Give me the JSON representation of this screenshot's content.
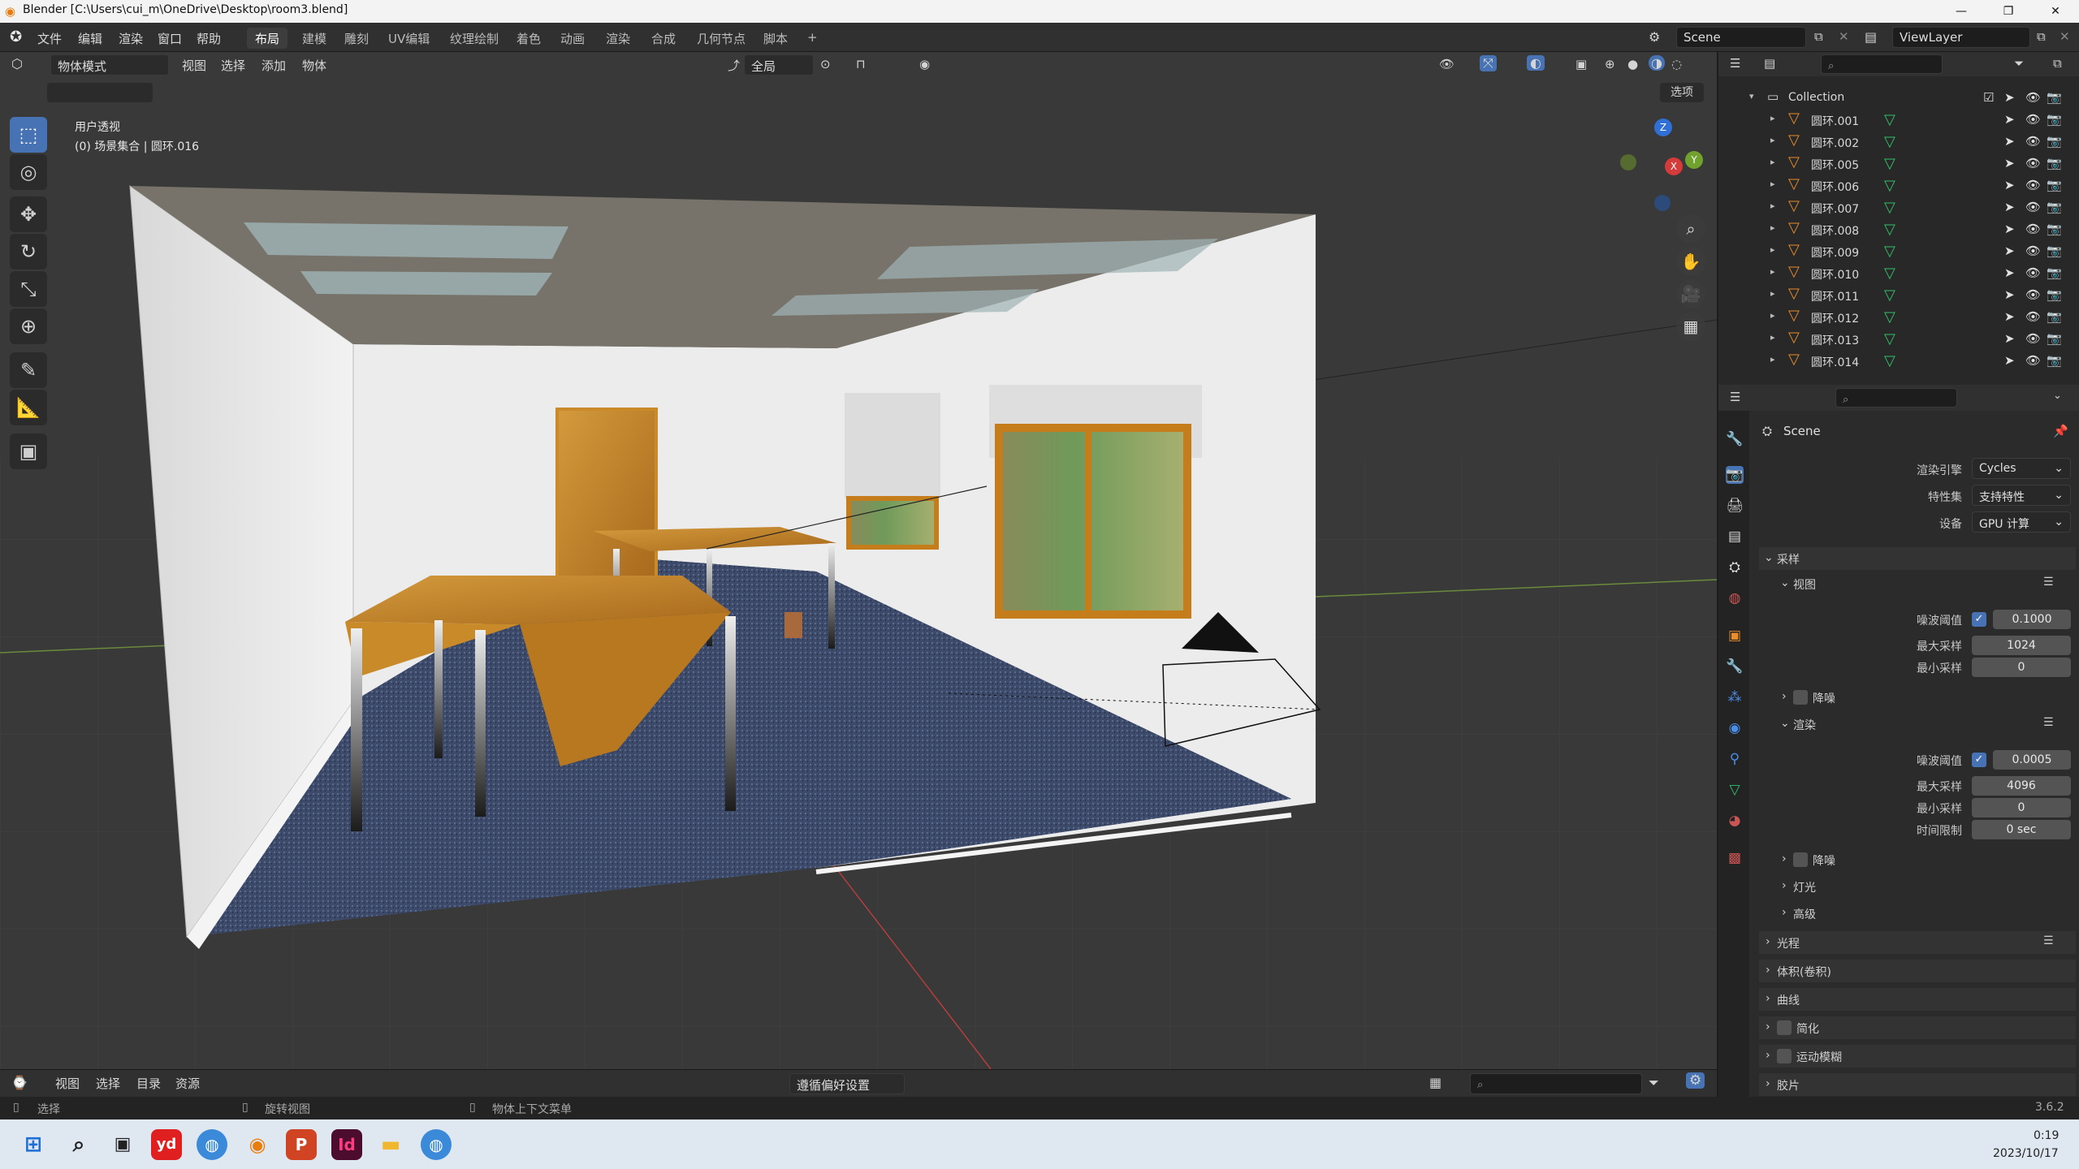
{
  "window": {
    "title": "Blender [C:\\Users\\cui_m\\OneDrive\\Desktop\\room3.blend]",
    "minimize": "—",
    "maximize": "❐",
    "close": "✕"
  },
  "menu": {
    "file": "文件",
    "edit": "编辑",
    "render": "渲染",
    "window": "窗口",
    "help": "帮助"
  },
  "workspaces": [
    "布局",
    "建模",
    "雕刻",
    "UV编辑",
    "纹理绘制",
    "着色",
    "动画",
    "渲染",
    "合成",
    "几何节点",
    "脚本"
  ],
  "add_workspace": "+",
  "scene": {
    "name": "Scene",
    "view_layer": "ViewLayer"
  },
  "viewport": {
    "mode": "物体模式",
    "menus": [
      "视图",
      "选择",
      "添加",
      "物体"
    ],
    "transform_orientation": "全局",
    "options": "选项",
    "view_name": "用户透视",
    "context": "(0) 场景集合 | 圆环.016"
  },
  "gizmo": {
    "z": "Z",
    "y": "Y",
    "x": "X"
  },
  "outliner": {
    "collection": "Collection",
    "objects": [
      "圆环.001",
      "圆环.002",
      "圆环.005",
      "圆环.006",
      "圆环.007",
      "圆环.008",
      "圆环.009",
      "圆环.010",
      "圆环.011",
      "圆环.012",
      "圆环.013",
      "圆环.014"
    ]
  },
  "properties": {
    "scene": "Scene",
    "render_engine_label": "渲染引擎",
    "render_engine": "Cycles",
    "feature_set_label": "特性集",
    "feature_set": "支持特性",
    "device_label": "设备",
    "device": "GPU 计算",
    "sampling": "采样",
    "viewport_section": "视图",
    "noise_threshold_label": "噪波阈值",
    "vp_noise_threshold": "0.1000",
    "max_samples_label": "最大采样",
    "vp_max_samples": "1024",
    "min_samples_label": "最小采样",
    "vp_min_samples": "0",
    "denoise": "降噪",
    "render_section": "渲染",
    "r_noise_threshold": "0.0005",
    "r_max_samples": "4096",
    "r_min_samples": "0",
    "time_limit_label": "时间限制",
    "r_time_limit": "0 sec",
    "lights": "灯光",
    "advanced": "高级",
    "light_paths": "光程",
    "volumes": "体积(卷积)",
    "curves": "曲线",
    "simplify": "简化",
    "motion_blur": "运动模糊",
    "film": "胶片"
  },
  "timeline": {
    "menus": [
      "视图",
      "选择",
      "目录",
      "资源"
    ],
    "preferences": "遵循偏好设置"
  },
  "status": {
    "select": "选择",
    "rotate": "旋转视图",
    "context_menu": "物体上下文菜单",
    "version": "3.6.2"
  },
  "taskbar": {
    "time": "0:19",
    "date": "2023/10/17"
  },
  "colors": {
    "accent": "#4772b3",
    "mesh_orange": "#e98c2c",
    "mesh_green": "#33c16b"
  }
}
